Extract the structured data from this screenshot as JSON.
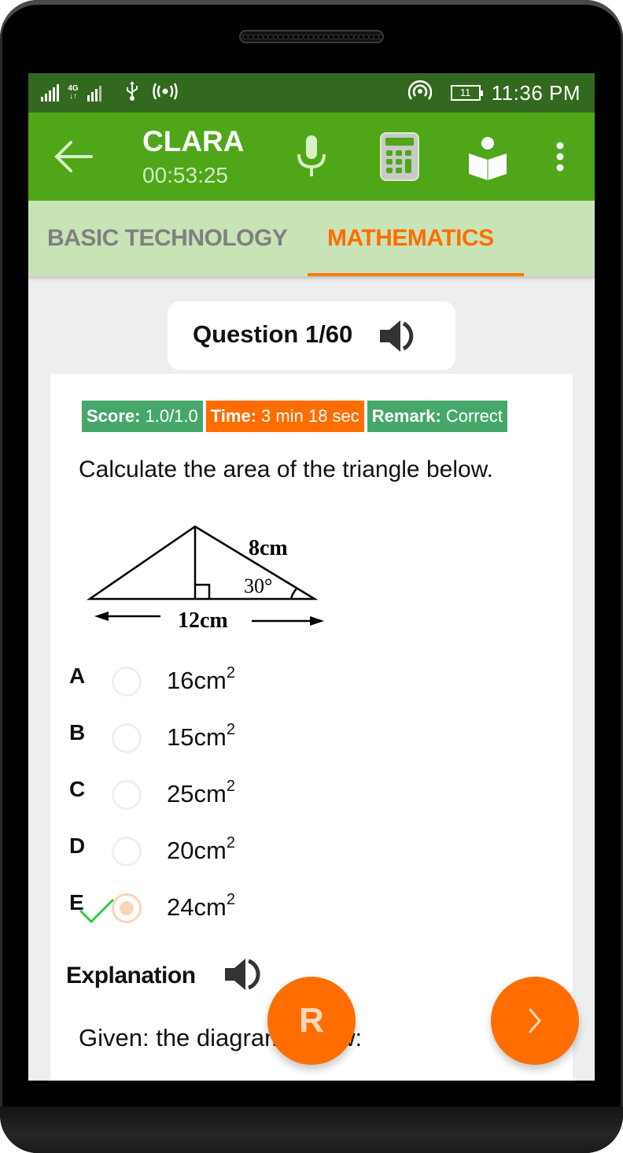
{
  "status_bar": {
    "network_type": "4G",
    "battery_level": "11",
    "time": "11:36 PM",
    "icons": [
      "signal-icon",
      "4g-data-icon",
      "signal-icon",
      "usb-icon",
      "broadcast-icon",
      "hotspot-icon",
      "battery-icon"
    ]
  },
  "app_bar": {
    "title": "CLARA",
    "timer": "00:53:25",
    "icons": [
      "back-arrow-icon",
      "microphone-icon",
      "calculator-icon",
      "reading-book-icon",
      "more-vert-icon"
    ]
  },
  "tabs": [
    {
      "label": "BASIC TECHNOLOGY",
      "active": false
    },
    {
      "label": "MATHEMATICS",
      "active": true
    }
  ],
  "question": {
    "header": "Question 1/60",
    "text": "Calculate the area of the triangle below.",
    "badges": {
      "score_label": "Score:",
      "score_value": "1.0/1.0",
      "time_label": "Time:",
      "time_value": "3 min 18 sec",
      "remark_label": "Remark:",
      "remark_value": "Correct"
    },
    "diagram": {
      "hypotenuse_label": "8cm",
      "angle_label": "30°",
      "base_label": "12cm"
    },
    "options": [
      {
        "letter": "A",
        "value": "16cm",
        "exp": "2",
        "selected": false,
        "correct": false
      },
      {
        "letter": "B",
        "value": "15cm",
        "exp": "2",
        "selected": false,
        "correct": false
      },
      {
        "letter": "C",
        "value": "25cm",
        "exp": "2",
        "selected": false,
        "correct": false
      },
      {
        "letter": "D",
        "value": "20cm",
        "exp": "2",
        "selected": false,
        "correct": false
      },
      {
        "letter": "E",
        "value": "24cm",
        "exp": "2",
        "selected": true,
        "correct": true
      }
    ]
  },
  "explanation": {
    "title": "Explanation",
    "text": "Given: the diagram below:"
  },
  "fab": {
    "review_label": "R",
    "next_icon": "chevron-right-icon"
  },
  "colors": {
    "status_bar": "#33691e",
    "app_bar": "#4ea618",
    "tabs_bg": "#c8e4b6",
    "accent": "#ff6d00",
    "badge_green": "#45a86a"
  }
}
